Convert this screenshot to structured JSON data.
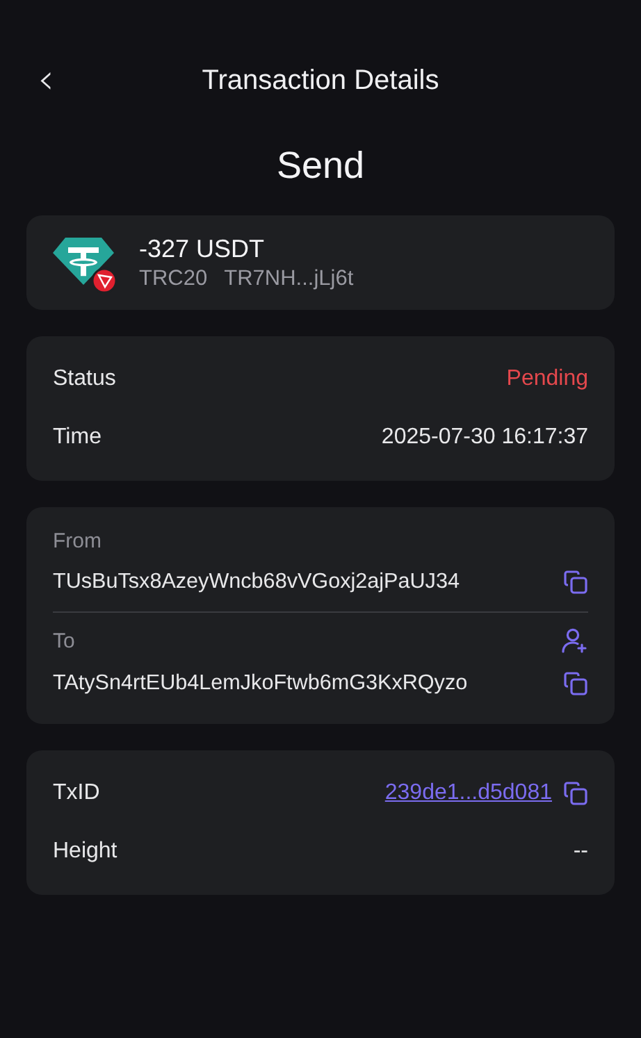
{
  "header": {
    "back_icon": "‹",
    "title": "Transaction Details"
  },
  "type_heading": "Send",
  "asset": {
    "amount": "-327 USDT",
    "network": "TRC20",
    "address": "TR7NH...jLj6t"
  },
  "summary": [
    {
      "label": "Status",
      "value": "Pending",
      "kind": "status"
    },
    {
      "label": "Time",
      "value": "2025-07-30 16:17:37",
      "kind": "text"
    }
  ],
  "addresses": [
    {
      "label": "From",
      "value": "TUsBuTsx8AzeyWncb68vVGoxj2ajPaUJ34",
      "add_contact": false
    },
    {
      "label": "To",
      "value": "TAtySn4rtEUb4LemJkoFtwb6mG3KxRQyzo",
      "add_contact": true
    }
  ],
  "chain": [
    {
      "label": "TxID",
      "value": "239de1...d5d081",
      "kind": "link"
    },
    {
      "label": "Height",
      "value": "--",
      "kind": "text"
    }
  ]
}
